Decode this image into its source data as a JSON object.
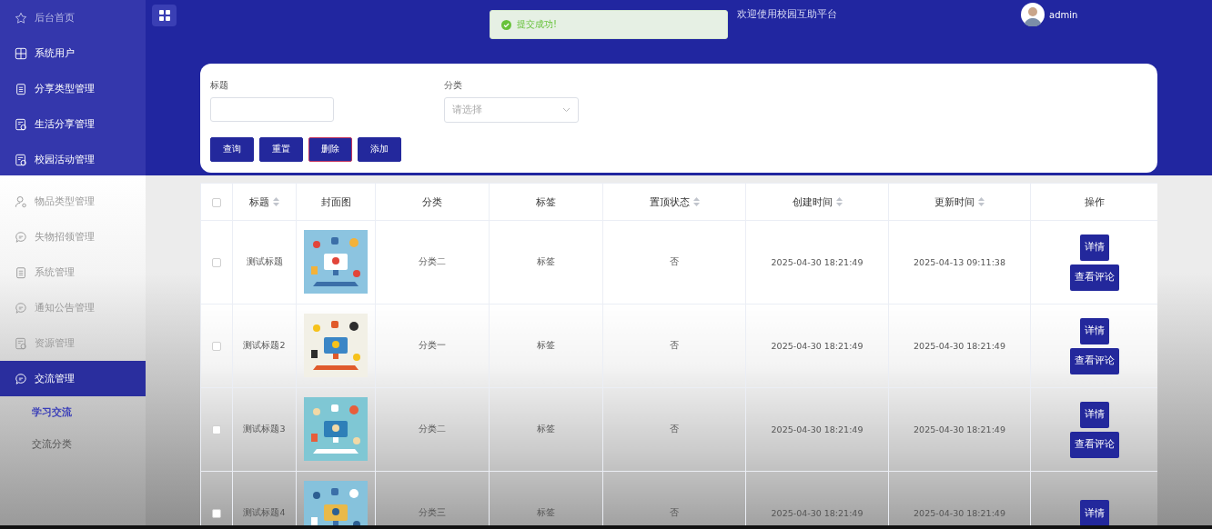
{
  "sidebar": {
    "items": [
      {
        "label": "后台首页",
        "selected": false,
        "muted": true
      },
      {
        "label": "系统用户",
        "selected": false,
        "muted": false
      },
      {
        "label": "分享类型管理",
        "selected": false,
        "muted": false
      },
      {
        "label": "生活分享管理",
        "selected": false,
        "muted": false
      },
      {
        "label": "校园活动管理",
        "selected": false,
        "muted": false
      },
      {
        "label": "物品类型管理",
        "selected": false,
        "muted": false
      },
      {
        "label": "失物招领管理",
        "selected": false,
        "muted": false
      },
      {
        "label": "系统管理",
        "selected": false,
        "muted": false
      },
      {
        "label": "通知公告管理",
        "selected": false,
        "muted": false
      },
      {
        "label": "资源管理",
        "selected": false,
        "muted": false
      },
      {
        "label": "交流管理",
        "selected": true,
        "muted": false,
        "children": [
          {
            "label": "学习交流",
            "selected": true
          },
          {
            "label": "交流分类",
            "selected": false
          }
        ]
      }
    ]
  },
  "header": {
    "title": "欢迎使用校园互助平台",
    "user": "admin",
    "toast": {
      "kind": "success",
      "text": "提交成功!"
    }
  },
  "search": {
    "fields": [
      {
        "label": "标题",
        "kind": "input"
      },
      {
        "label": "分类",
        "kind": "select",
        "placeholder": "请选择"
      }
    ],
    "buttons": [
      {
        "label": "查询",
        "kind": "primary"
      },
      {
        "label": "重置",
        "kind": "primary"
      },
      {
        "label": "删除",
        "kind": "danger"
      },
      {
        "label": "添加",
        "kind": "primary"
      }
    ]
  },
  "table": {
    "all_checked": false,
    "columns": [
      {
        "label": "标题",
        "sortable": true
      },
      {
        "label": "封面图",
        "sortable": false
      },
      {
        "label": "分类",
        "sortable": false
      },
      {
        "label": "标签",
        "sortable": false
      },
      {
        "label": "置顶状态",
        "sortable": true
      },
      {
        "label": "创建时间",
        "sortable": true
      },
      {
        "label": "更新时间",
        "sortable": true
      },
      {
        "label": "操作",
        "sortable": false
      }
    ],
    "rows": [
      {
        "checked": false,
        "title": "测试标题",
        "cover": {
          "kind": "picture"
        },
        "category": "分类二",
        "tag": "标签",
        "pinned": "否",
        "created": "2025-04-30 18:21:49",
        "updated": "2025-04-13 09:11:38",
        "actions": [
          "详情",
          "查看评论"
        ]
      },
      {
        "checked": false,
        "title": "测试标题2",
        "cover": {
          "kind": "picture"
        },
        "category": "分类一",
        "tag": "标签",
        "pinned": "否",
        "created": "2025-04-30 18:21:49",
        "updated": "2025-04-30 18:21:49",
        "actions": [
          "详情",
          "查看评论"
        ]
      },
      {
        "checked": false,
        "title": "测试标题3",
        "cover": {
          "kind": "picture"
        },
        "category": "分类二",
        "tag": "标签",
        "pinned": "否",
        "created": "2025-04-30 18:21:49",
        "updated": "2025-04-30 18:21:49",
        "actions": [
          "详情",
          "查看评论"
        ]
      },
      {
        "checked": false,
        "title": "测试标题4",
        "cover": {
          "kind": "picture"
        },
        "category": "分类三",
        "tag": "标签",
        "pinned": "否",
        "created": "2025-04-30 18:21:49",
        "updated": "2025-04-30 18:21:49",
        "actions": [
          "详情"
        ]
      }
    ]
  }
}
